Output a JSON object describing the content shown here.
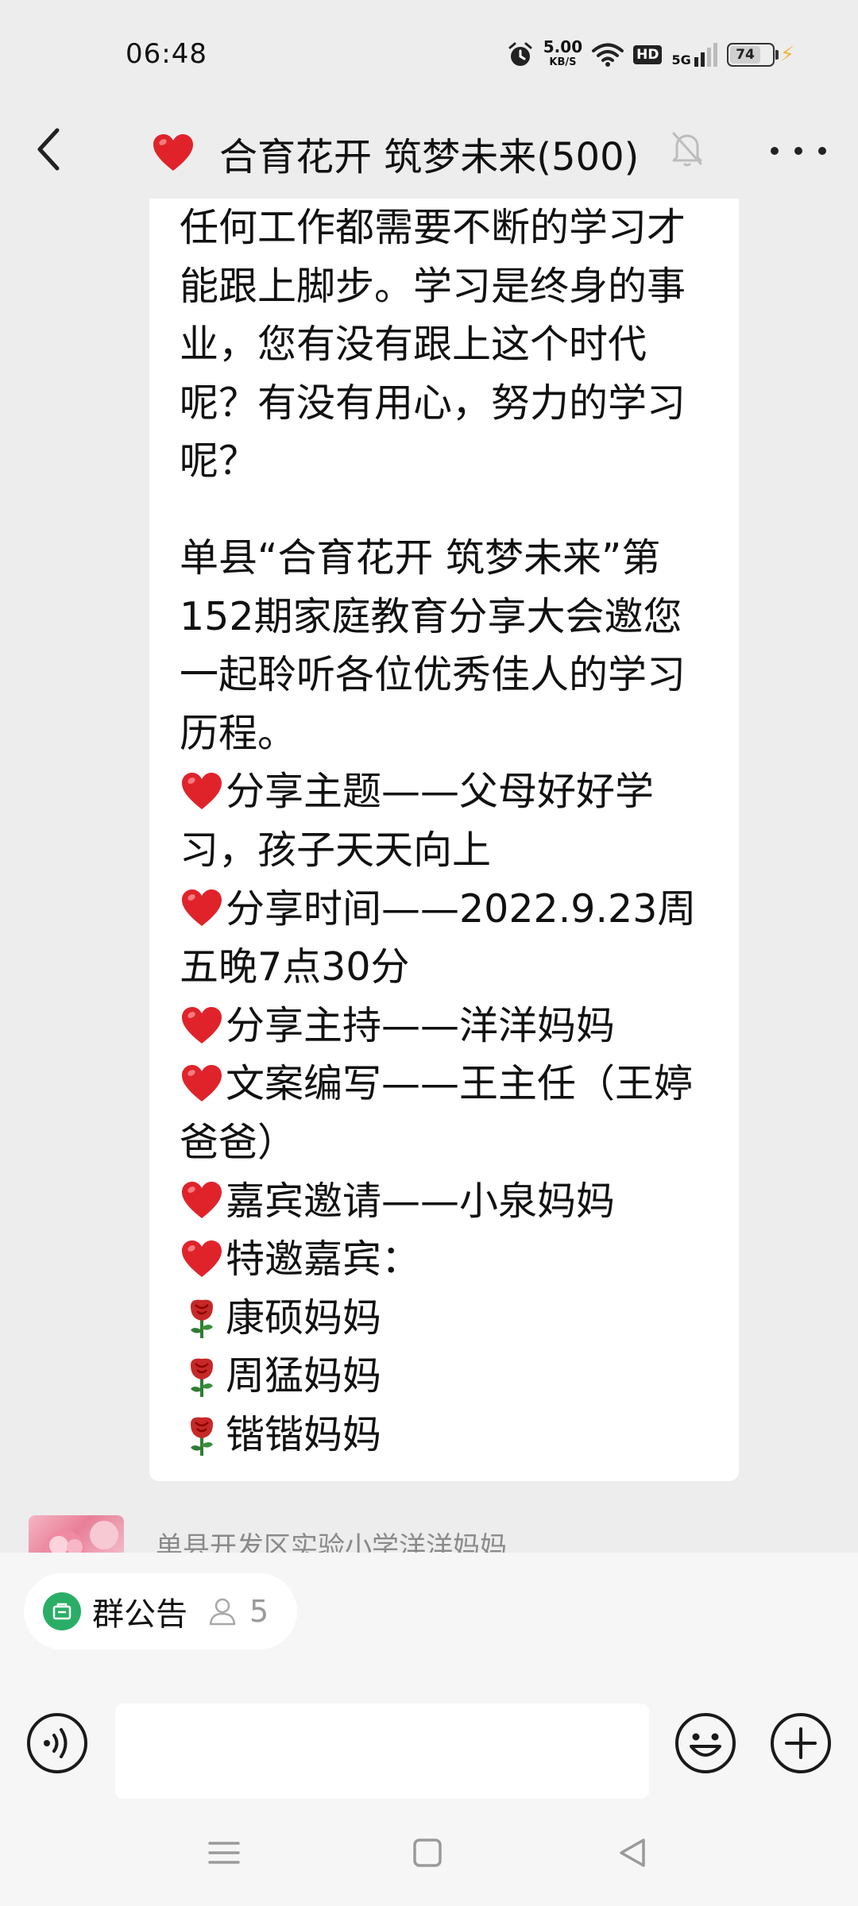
{
  "status_bar": {
    "time": "06:48",
    "net_speed_value": "5.00",
    "net_speed_unit": "KB/S",
    "hd_label": "HD",
    "network_label": "5G",
    "battery_percent": "74",
    "battery_level": 0.74
  },
  "header": {
    "title": "合育花开 筑梦未来(500)",
    "title_icon": "red-heart-emoji",
    "muted": true
  },
  "message": {
    "lines": [
      {
        "icon": "",
        "text": "任何工作都需要不断的学习才"
      },
      {
        "icon": "",
        "text": "能跟上脚步。学习是终身的事"
      },
      {
        "icon": "",
        "text": "业，您有没有跟上这个时代"
      },
      {
        "icon": "",
        "text": "呢？有没有用心，努力的学习"
      },
      {
        "icon": "",
        "text": "呢？"
      },
      {
        "icon": "",
        "text": ""
      },
      {
        "icon": "",
        "text": "单县“合育花开 筑梦未来”第"
      },
      {
        "icon": "",
        "text": "152期家庭教育分享大会邀您"
      },
      {
        "icon": "",
        "text": "一起聆听各位优秀佳人的学习"
      },
      {
        "icon": "",
        "text": "历程。"
      },
      {
        "icon": "heart",
        "text": "分享主题——父母好好学"
      },
      {
        "icon": "",
        "text": "习，孩子天天向上"
      },
      {
        "icon": "heart",
        "text": "分享时间——2022.9.23周"
      },
      {
        "icon": "",
        "text": "五晚7点30分"
      },
      {
        "icon": "heart",
        "text": "分享主持——洋洋妈妈"
      },
      {
        "icon": "heart",
        "text": "文案编写——王主任（王婷"
      },
      {
        "icon": "",
        "text": "爸爸）"
      },
      {
        "icon": "heart",
        "text": "嘉宾邀请——小泉妈妈"
      },
      {
        "icon": "heart",
        "text": "特邀嘉宾："
      },
      {
        "icon": "rose",
        "text": "康硕妈妈"
      },
      {
        "icon": "rose",
        "text": "周猛妈妈"
      },
      {
        "icon": "rose",
        "text": "锴锴妈妈"
      }
    ]
  },
  "next_message": {
    "sender": "单县开发区实验小学洋洋妈妈"
  },
  "bottom": {
    "notice_label": "群公告",
    "notice_count": "5",
    "input_value": "",
    "input_placeholder": ""
  },
  "colors": {
    "background": "#ededed",
    "bubble": "#ffffff",
    "heart": "#e0232b",
    "notice_green": "#2aae67",
    "charging": "#f2b63a"
  }
}
